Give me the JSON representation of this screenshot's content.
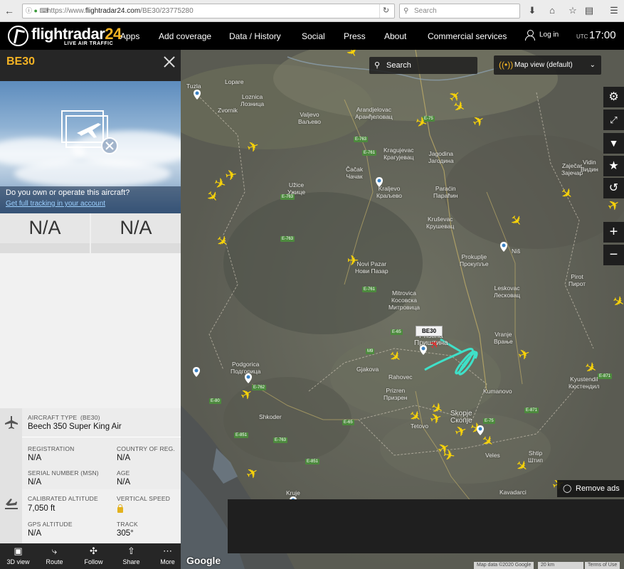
{
  "browser": {
    "url_prefix": "https://www.",
    "url_host": "flightradar24.com",
    "url_path": "/BE30/23775280",
    "search_placeholder": "Search"
  },
  "header": {
    "logo_main": "flightradar",
    "logo_num": "24",
    "logo_sub": "LIVE AIR TRAFFIC",
    "menu": [
      "Apps",
      "Add coverage",
      "Data / History",
      "Social",
      "Press",
      "About",
      "Commercial services"
    ],
    "login": "Log in",
    "utc_label": "UTC",
    "utc_time": "17:00"
  },
  "panel": {
    "callsign": "BE30",
    "own_question": "Do you own or operate this aircraft?",
    "own_link": "Get full tracking in your account",
    "na_left": "N/A",
    "na_right": "N/A",
    "aircraft_type_label": "AIRCRAFT TYPE",
    "aircraft_type_code": "(BE30)",
    "aircraft_type_value": "Beech 350 Super King Air",
    "registration_label": "REGISTRATION",
    "registration_value": "N/A",
    "country_label": "COUNTRY OF REG.",
    "country_value": "N/A",
    "serial_label": "SERIAL NUMBER (MSN)",
    "serial_value": "N/A",
    "age_label": "AGE",
    "age_value": "N/A",
    "cal_alt_label": "CALIBRATED ALTITUDE",
    "cal_alt_value": "7,050 ft",
    "vspeed_label": "VERTICAL SPEED",
    "gps_alt_label": "GPS ALTITUDE",
    "gps_alt_value": "N/A",
    "track_label": "TRACK",
    "track_value": "305°",
    "footer": [
      "3D view",
      "Route",
      "Follow",
      "Share",
      "More"
    ]
  },
  "map": {
    "search_label": "Search",
    "view_label": "Map view (default)",
    "aircraft_label": "BE30",
    "remove_ads": "Remove ads",
    "google": "Google",
    "attribution": [
      "Map data ©2020 Google",
      "20 km",
      "Terms of Use"
    ],
    "places": [
      {
        "t": "Tuzla"
      },
      {
        "t": "Lopare"
      },
      {
        "t": "Zvornik"
      },
      {
        "t": "Loznica\nЛозница"
      },
      {
        "t": "Valjevo\nВаљево"
      },
      {
        "t": "Arandjelovac\nАранђеловац"
      },
      {
        "t": "Kragujevac\nКрагујевац"
      },
      {
        "t": "Jagodina\nЈагодина"
      },
      {
        "t": "Čačak\nЧачак"
      },
      {
        "t": "Užice\nУжице"
      },
      {
        "t": "Kraljevo\nКраљево"
      },
      {
        "t": "Paraćin\nПараћин"
      },
      {
        "t": "Kruševac\nКрушевац"
      },
      {
        "t": "Novi Pazar\nНови Пазар"
      },
      {
        "t": "Prokuplje\nПрокупље"
      },
      {
        "t": "Mitrovica\nКосовска\nМитровица"
      },
      {
        "t": "Leskovac\nЛесковац"
      },
      {
        "t": "Vranje\nВрање"
      },
      {
        "t": "Gjakova"
      },
      {
        "t": "Prizren\nПризрен"
      },
      {
        "t": "Podgorica\nПодгорица"
      },
      {
        "t": "Skopje\nСкопје"
      },
      {
        "t": "Kumanovo"
      },
      {
        "t": "Tetovo"
      },
      {
        "t": "Veles"
      },
      {
        "t": "Shtip\nШтип"
      },
      {
        "t": "Kyustendil\nКюстендил"
      },
      {
        "t": "Pirot\nПирот"
      },
      {
        "t": "Niš"
      },
      {
        "t": "Shkoder"
      },
      {
        "t": "Kruje"
      },
      {
        "t": "Kavadarci"
      },
      {
        "t": "Zaječar\nЗајечар"
      },
      {
        "t": "Vidin\nВидин"
      },
      {
        "t": "Pristina\nПриштина"
      },
      {
        "t": "Rahovec"
      }
    ],
    "roads": [
      "E-75",
      "E-763",
      "E-761",
      "E-80",
      "E-65",
      "E-851",
      "E-762",
      "E-871",
      "M9"
    ]
  },
  "colors": {
    "accent": "#f4b324",
    "plane": "#f7d20a",
    "track": "#3fe0c8",
    "header_bg": "#000000"
  },
  "icons": [
    "back-icon",
    "forward-icon",
    "lock-icon",
    "reload-icon",
    "search-icon",
    "download-icon",
    "home-icon",
    "bookmark-icon",
    "clipboard-icon",
    "menu-icon",
    "user-icon",
    "close-icon",
    "settings-icon",
    "fullscreen-icon",
    "filter-icon",
    "star-icon",
    "playback-icon",
    "zoom-in-icon",
    "zoom-out-icon",
    "plane-icon",
    "bulb-icon"
  ]
}
